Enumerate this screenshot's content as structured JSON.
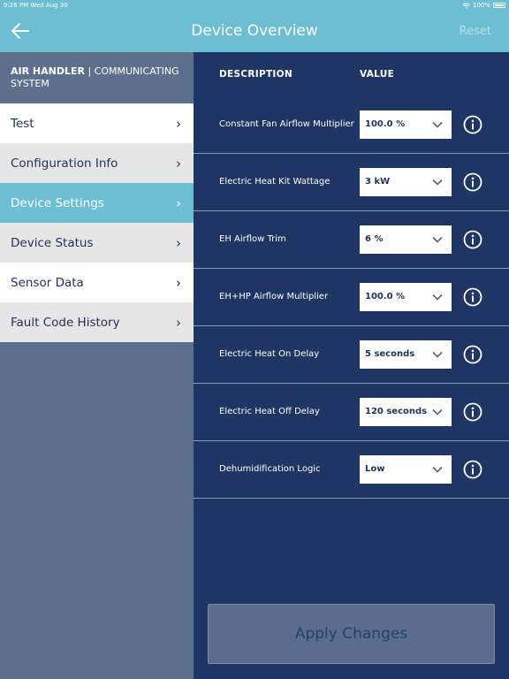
{
  "status_bar": {
    "time_date": "9:26 PM   Wed Aug 30",
    "battery": "100%"
  },
  "header": {
    "title": "Device Overview",
    "reset": "Reset"
  },
  "sidebar": {
    "heading_bold": "AIR HANDLER",
    "heading_rest": " | COMMUNICATING SYSTEM",
    "items": [
      {
        "label": "Test",
        "style": "white"
      },
      {
        "label": "Configuration Info",
        "style": "grey"
      },
      {
        "label": "Device Settings",
        "style": "active"
      },
      {
        "label": "Device Status",
        "style": "grey"
      },
      {
        "label": "Sensor Data",
        "style": "white"
      },
      {
        "label": "Fault Code History",
        "style": "grey"
      }
    ]
  },
  "table": {
    "col_description": "DESCRIPTION",
    "col_value": "VALUE",
    "rows": [
      {
        "label": "Constant Fan Airflow Multiplier",
        "value": "100.0 %"
      },
      {
        "label": "Electric Heat Kit Wattage",
        "value": "3 kW"
      },
      {
        "label": "EH Airflow Trim",
        "value": "6 %"
      },
      {
        "label": "EH+HP Airflow Multiplier",
        "value": "100.0 %"
      },
      {
        "label": "Electric Heat On Delay",
        "value": "5 seconds"
      },
      {
        "label": "Electric Heat Off Delay",
        "value": "120 seconds"
      },
      {
        "label": "Dehumidification Logic",
        "value": "Low"
      }
    ]
  },
  "apply_button": "Apply Changes",
  "colors": {
    "accent": "#6cbfd3",
    "main_bg": "#1f3563",
    "sidebar_bg": "#5c6f8d"
  }
}
